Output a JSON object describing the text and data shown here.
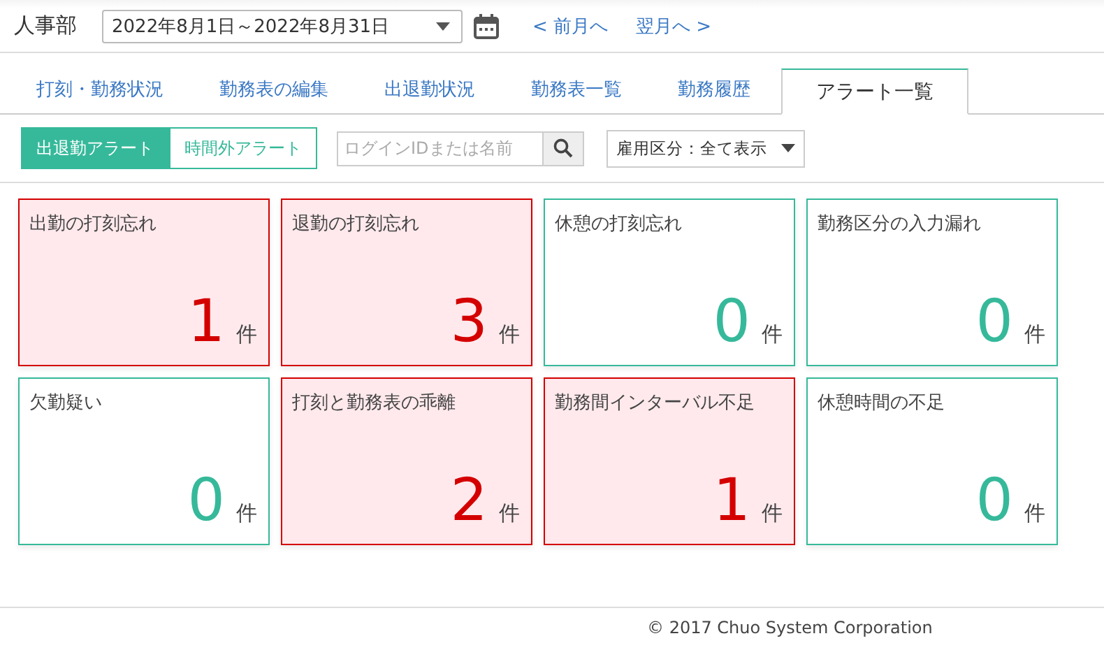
{
  "header": {
    "department": "人事部",
    "period": "2022年8月1日～2022年8月31日",
    "prev_link": "< 前月へ",
    "next_link": "翌月へ >"
  },
  "tabs": [
    {
      "label": "打刻・勤務状況",
      "selected": false
    },
    {
      "label": "勤務表の編集",
      "selected": false
    },
    {
      "label": "出退勤状況",
      "selected": false
    },
    {
      "label": "勤務表一覧",
      "selected": false
    },
    {
      "label": "勤務履歴",
      "selected": false
    },
    {
      "label": "アラート一覧",
      "selected": true
    }
  ],
  "alert_types": [
    {
      "label": "出退勤アラート",
      "selected": true
    },
    {
      "label": "時間外アラート",
      "selected": false
    }
  ],
  "search": {
    "placeholder": "ログインIDまたは名前"
  },
  "employment_filter": {
    "value": "雇用区分：全て表示"
  },
  "cards": [
    {
      "title": "出勤の打刻忘れ",
      "count": "1",
      "unit": "件",
      "alert": true
    },
    {
      "title": "退勤の打刻忘れ",
      "count": "3",
      "unit": "件",
      "alert": true
    },
    {
      "title": "休憩の打刻忘れ",
      "count": "0",
      "unit": "件",
      "alert": false
    },
    {
      "title": "勤務区分の入力漏れ",
      "count": "0",
      "unit": "件",
      "alert": false
    },
    {
      "title": "欠勤疑い",
      "count": "0",
      "unit": "件",
      "alert": false
    },
    {
      "title": "打刻と勤務表の乖離",
      "count": "2",
      "unit": "件",
      "alert": true
    },
    {
      "title": "勤務間インターバル不足",
      "count": "1",
      "unit": "件",
      "alert": true
    },
    {
      "title": "休憩時間の不足",
      "count": "0",
      "unit": "件",
      "alert": false
    }
  ],
  "footer": "© 2017 Chuo System Corporation"
}
